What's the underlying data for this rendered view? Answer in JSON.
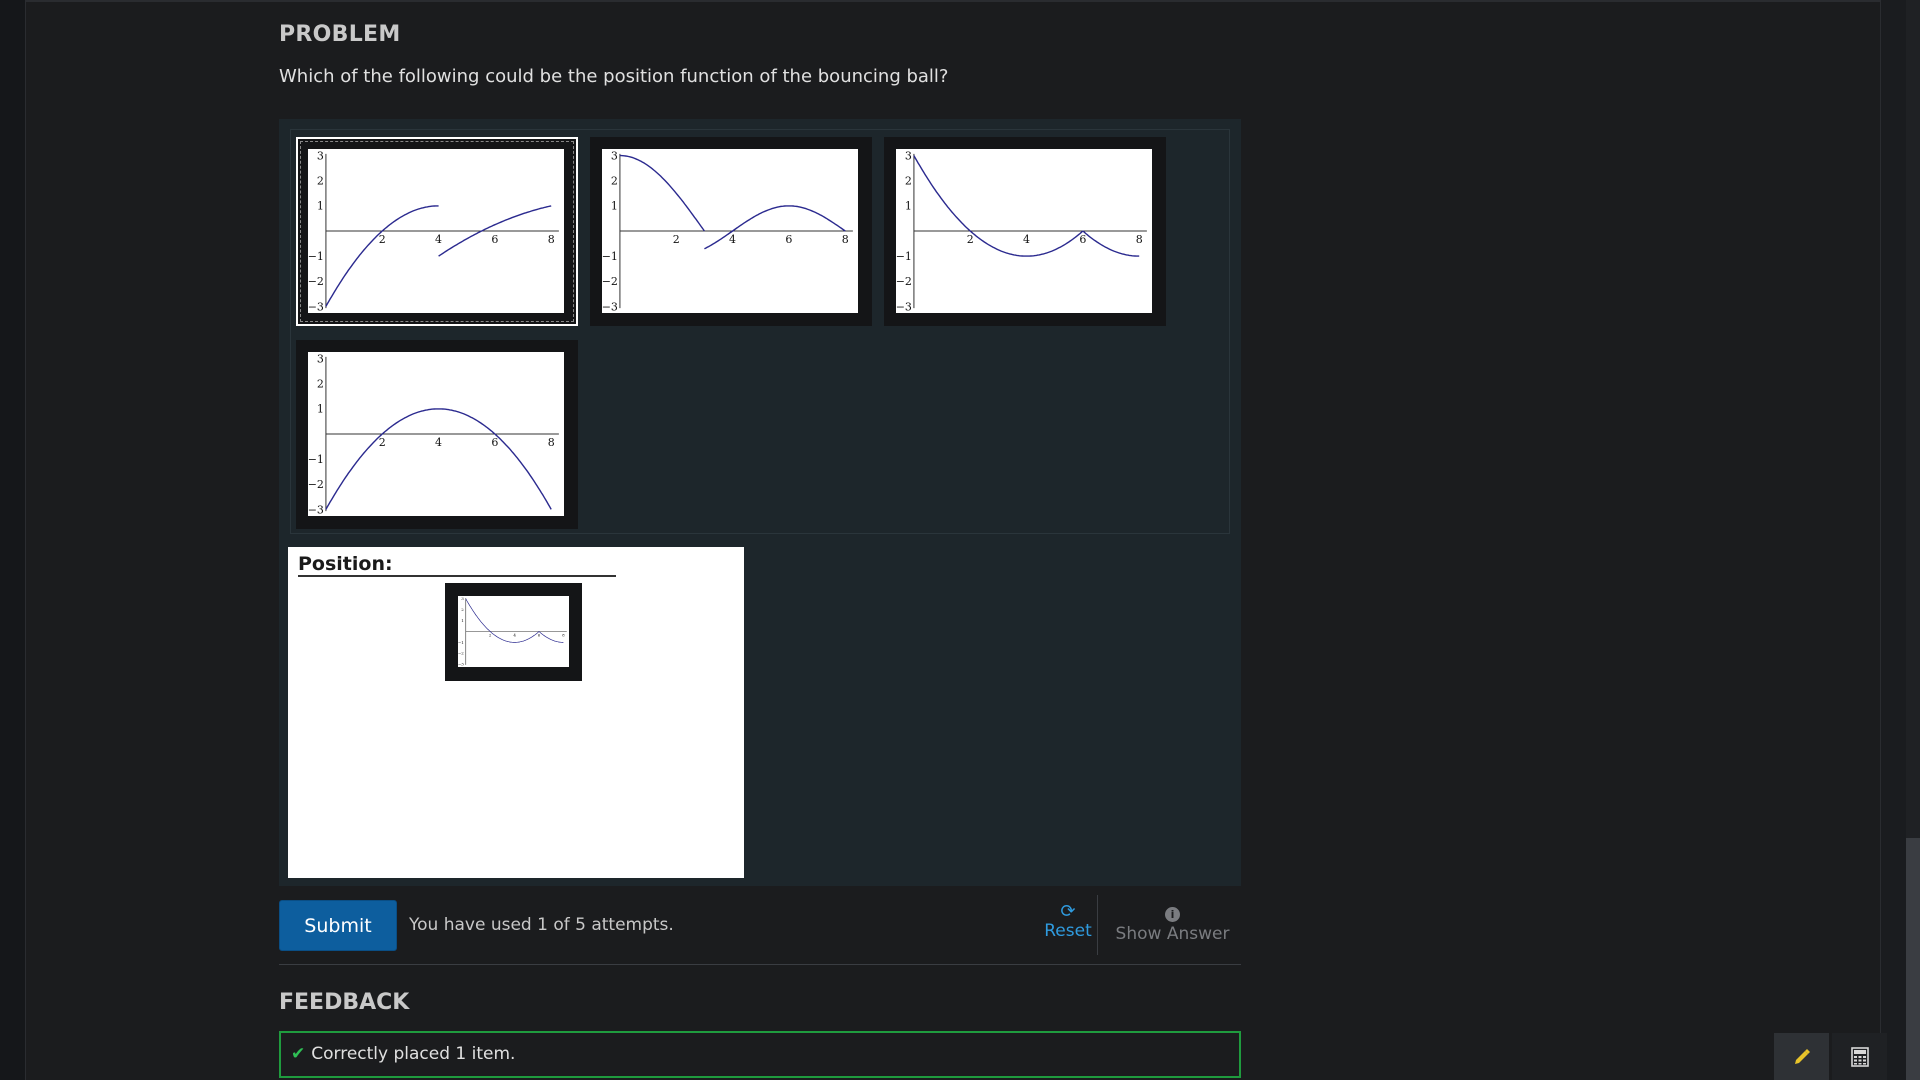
{
  "problem": {
    "heading": "PROBLEM",
    "question": "Which of the following could be the position function of the bouncing ball?"
  },
  "plot_axes": {
    "x_ticks": [
      "2",
      "4",
      "6",
      "8"
    ],
    "y_ticks": [
      "3",
      "2",
      "1",
      "−1",
      "−2",
      "−3"
    ]
  },
  "items": [
    {
      "id": "graph-a",
      "selected": true
    },
    {
      "id": "graph-b",
      "selected": false
    },
    {
      "id": "graph-c",
      "selected": false
    },
    {
      "id": "graph-d",
      "selected": false
    }
  ],
  "target": {
    "label": "Position:"
  },
  "actions": {
    "submit_label": "Submit",
    "attempts_text": "You have used 1 of 5 attempts.",
    "reset_label": "Reset",
    "show_answer_label": "Show Answer"
  },
  "feedback": {
    "heading": "FEEDBACK",
    "message": "Correctly placed 1 item.",
    "status_color": "#1f9b3e"
  },
  "colors": {
    "accent": "#0d5e9e",
    "link": "#2f9bdf",
    "curve": "#2b2a8f"
  },
  "icons": [
    "refresh-icon",
    "info-icon",
    "check-icon",
    "pencil-icon",
    "calculator-icon"
  ]
}
